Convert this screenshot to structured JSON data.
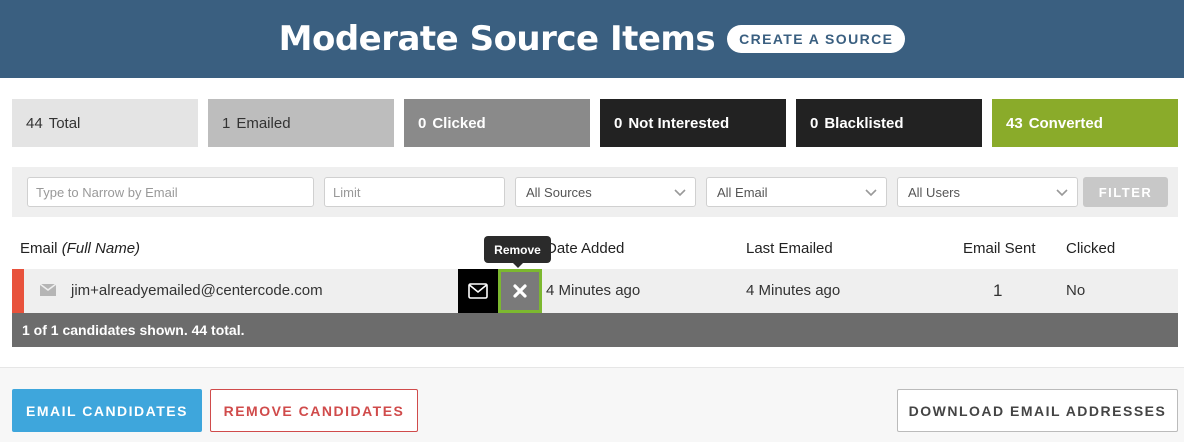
{
  "header": {
    "title": "Moderate Source Items",
    "create_button": "CREATE A SOURCE"
  },
  "stats": [
    {
      "count": "44",
      "label": "Total"
    },
    {
      "count": "1",
      "label": "Emailed"
    },
    {
      "count": "0",
      "label": "Clicked"
    },
    {
      "count": "0",
      "label": "Not Interested"
    },
    {
      "count": "0",
      "label": "Blacklisted"
    },
    {
      "count": "43",
      "label": "Converted"
    }
  ],
  "filters": {
    "email_placeholder": "Type to Narrow by Email",
    "limit_placeholder": "Limit",
    "sources_value": "All Sources",
    "email_value": "All Email",
    "users_value": "All Users",
    "filter_button": "FILTER"
  },
  "table": {
    "columns": {
      "email": "Email",
      "full_name": "(Full Name)",
      "date_added": "Date Added",
      "last_emailed": "Last Emailed",
      "email_sent": "Email Sent",
      "clicked": "Clicked"
    },
    "rows": [
      {
        "email": "jim+alreadyemailed@centercode.com",
        "date_added": "4 Minutes ago",
        "last_emailed": "4 Minutes ago",
        "email_sent": "1",
        "clicked": "No"
      }
    ],
    "tooltip": "Remove",
    "summary": "1 of 1 candidates shown. 44 total."
  },
  "actions": {
    "email_candidates": "EMAIL CANDIDATES",
    "remove_candidates": "REMOVE CANDIDATES",
    "download_addresses": "DOWNLOAD EMAIL ADDRESSES"
  },
  "colors": {
    "header_bg": "#3a5f80",
    "converted": "#8aab2a",
    "flag": "#e8523c",
    "primary": "#3ea6dc",
    "danger": "#d04b4b"
  },
  "icons": [
    "envelope-icon",
    "mail-icon",
    "close-icon",
    "chevron-down-icon"
  ]
}
